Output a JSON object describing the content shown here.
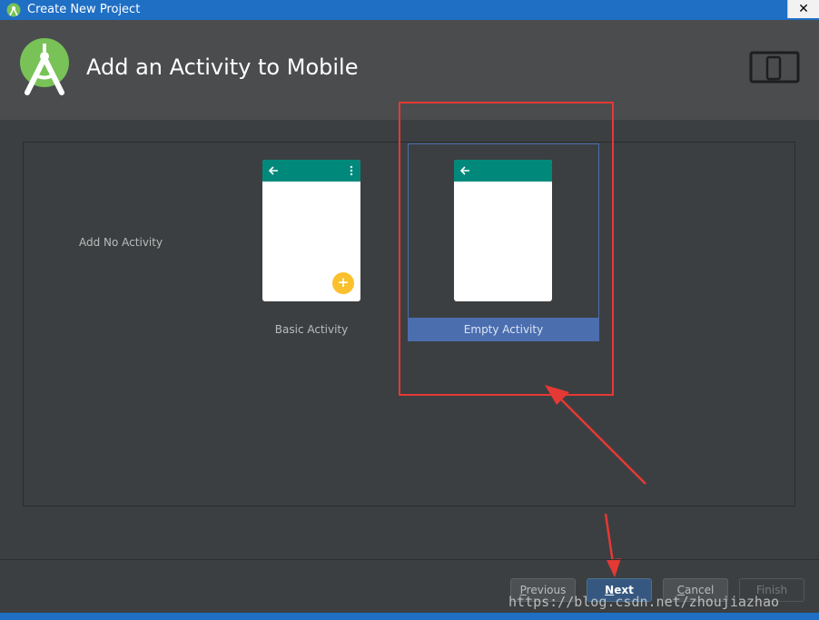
{
  "window": {
    "title": "Create New Project",
    "close_glyph": "✕"
  },
  "header": {
    "heading": "Add an Activity to Mobile",
    "logo_icon": "android-studio-logo",
    "device_icon": "phone-tablet-icon"
  },
  "gallery": {
    "no_activity_label": "Add No Activity",
    "cards": [
      {
        "label": "Basic Activity",
        "selected": false,
        "fab_glyph": "+"
      },
      {
        "label": "Empty Activity",
        "selected": true
      }
    ]
  },
  "buttons": {
    "previous": {
      "first": "P",
      "rest": "revious"
    },
    "next": {
      "first": "N",
      "rest": "ext"
    },
    "cancel": {
      "first": "C",
      "rest": "ancel"
    },
    "finish": {
      "label": "Finish"
    }
  },
  "watermark": "https://blog.csdn.net/zhoujiazhao",
  "colors": {
    "accent": "#4b6eaf",
    "toolbar": "#00897b",
    "fab": "#fbc02d",
    "annotation": "#e53935",
    "titlebar": "#1f6fc5"
  }
}
